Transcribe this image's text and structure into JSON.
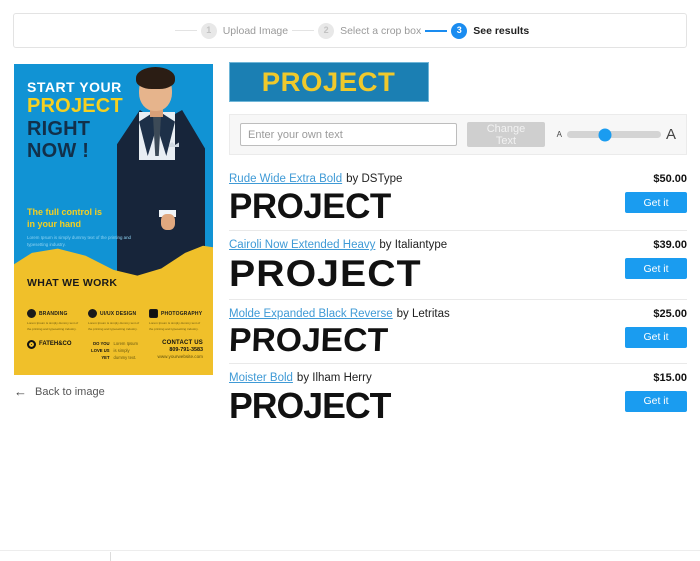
{
  "stepper": {
    "steps": [
      {
        "number": "1",
        "label": "Upload Image",
        "state": "done"
      },
      {
        "number": "2",
        "label": "Select a crop box",
        "state": "done"
      },
      {
        "number": "3",
        "label": "See results",
        "state": "active"
      }
    ]
  },
  "poster": {
    "headline_1": "START YOUR",
    "headline_2": "PROJECT",
    "headline_3": "RIGHT",
    "headline_4": "NOW !",
    "subhead_line_1": "The full control is",
    "subhead_line_2": "in your hand",
    "lorem": "Lorem Ipsum is simply dummy text of the printing and typesetting industry.",
    "section_title": "WHAT WE WORK",
    "services": [
      {
        "name": "BRANDING",
        "text": "Lorem Ipsum is simply dummy text of the printing and typesetting industry."
      },
      {
        "name": "UI/UX DESIGN",
        "text": "Lorem Ipsum is simply dummy text of the printing and typesetting industry."
      },
      {
        "name": "PHOTOGRAPHY",
        "text": "Lorem Ipsum is simply dummy text of the printing and typesetting industry."
      }
    ],
    "brand_name": "FATEH&CO",
    "love_labels": "DO YOU\nLOVE US\nYET",
    "love_text": "Lorem Ipsum\nis simply\ndummy text.",
    "contact_title": "CONTACT US",
    "contact_phone": "809-791-3583",
    "contact_web": "www.yourwebsite.com"
  },
  "back_link": {
    "label": "Back to image",
    "icon": "arrow-left-icon"
  },
  "preview": {
    "text": "PROJECT",
    "bg_color": "#1b7fb3",
    "text_color": "#efc92c"
  },
  "toolbar": {
    "input_value": "",
    "input_placeholder": "Enter your own text",
    "change_button": "Change Text",
    "size_small_label": "A",
    "size_large_label": "A",
    "slider_percent": 40
  },
  "fonts": [
    {
      "name": "Rude Wide Extra Bold",
      "by": "by DSType",
      "price": "$50.00",
      "buy_label": "Get it",
      "sample": "PROJECT"
    },
    {
      "name": "Cairoli Now Extended Heavy",
      "by": "by Italiantype",
      "price": "$39.00",
      "buy_label": "Get it",
      "sample": "PROJECT"
    },
    {
      "name": "Molde Expanded Black Reverse",
      "by": "by Letritas",
      "price": "$25.00",
      "buy_label": "Get it",
      "sample": "PROJECT"
    },
    {
      "name": "Moister Bold",
      "by": "by Ilham Herry",
      "price": "$15.00",
      "buy_label": "Get it",
      "sample": "PROJECT"
    }
  ],
  "colors": {
    "accent_blue": "#1a9cf0",
    "link_blue": "#3f9ad6",
    "poster_blue": "#1193d4",
    "poster_yellow": "#f0c02a"
  }
}
